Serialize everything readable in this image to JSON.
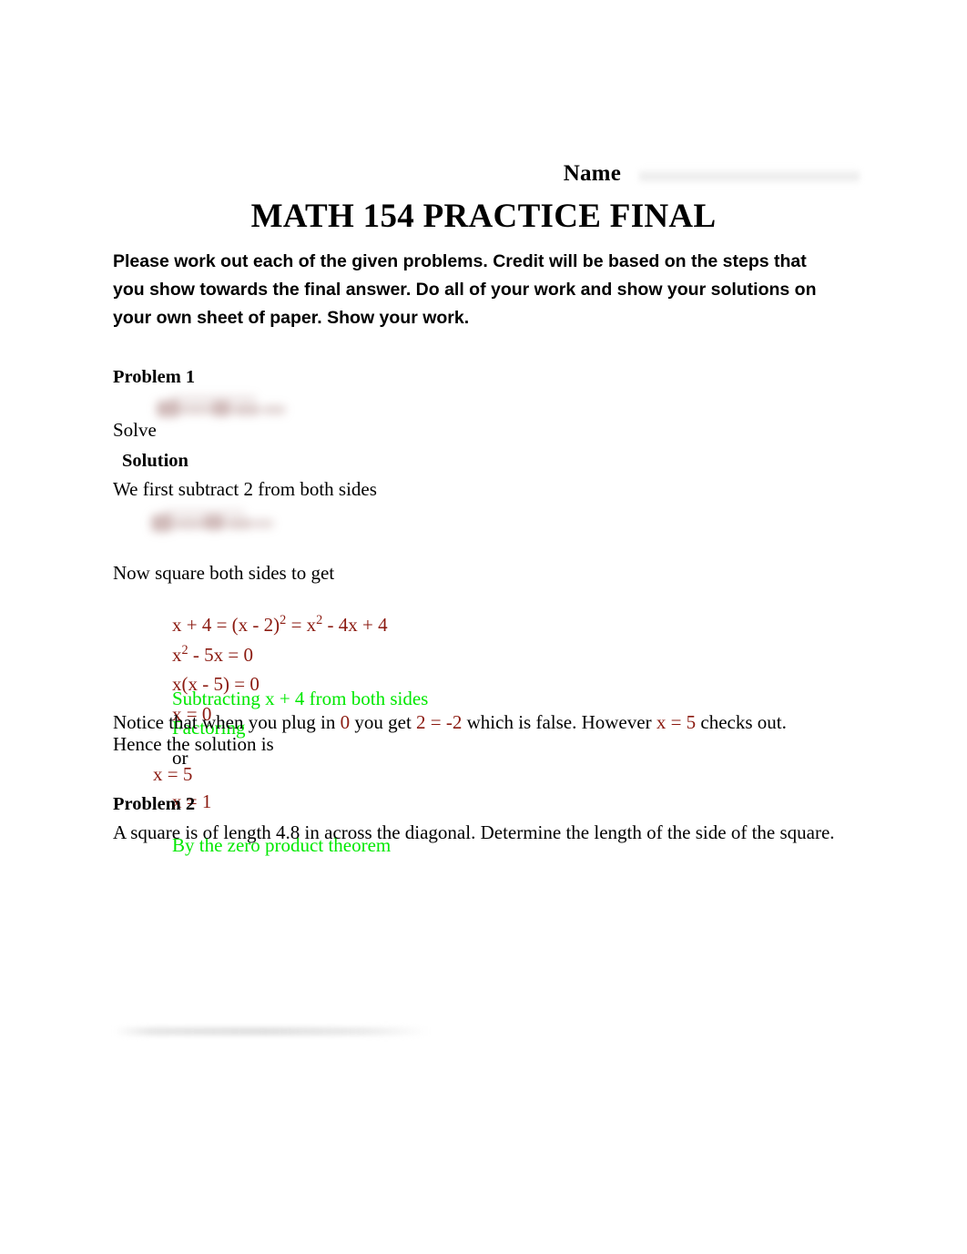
{
  "document": {
    "title": "MATH 154 PRACTICE FINAL",
    "name_label": "Name",
    "name_value": "",
    "instructions": "Please work out each of the given problems. Credit will be based on the steps that you show towards the final answer. Do all of your work and show your solutions on your own sheet of paper. Show your work."
  },
  "problem1": {
    "heading": "Problem 1",
    "prompt": "Solve",
    "prompt_equation_redacted": "",
    "solution_heading": "Solution",
    "step1_text": "We first subtract 2 from both sides",
    "step1_equation_redacted": "",
    "step2_text": "Now square both sides to get",
    "work": [
      {
        "expr_pre": "x + 4 = (x - 2)",
        "expr_sup": "2",
        "expr_post": " = x",
        "expr_sup2": "2",
        "expr_post2": " - 4x + 4",
        "note": ""
      },
      {
        "expr_pre": "x",
        "expr_sup": "2",
        "expr_post": " - 5x = 0",
        "note": "Subtracting x + 4 from both sides"
      },
      {
        "expr_pre": "x(x - 5) = 0",
        "note": "Factoring"
      }
    ],
    "zero_product_line": {
      "left": "x = 0",
      "conjunction": "or",
      "right": "x = 1",
      "note": "By the zero product theorem"
    },
    "check_sentence": {
      "part1": "Notice that when you plug in ",
      "value1": "0",
      "part2": " you get  ",
      "value2": "2 = -2",
      "part3": "  which is false. However  ",
      "value3": "x = 5",
      "part4": "  checks out. Hence the solution is"
    },
    "answer": "x = 5"
  },
  "problem2": {
    "heading": "Problem 2",
    "text": "A square is of length 4.8 in across the diagonal. Determine the length of the side of the square."
  },
  "colors": {
    "math": "#8B1A10",
    "annotation": "#00E800",
    "text": "#000000",
    "page": "#FFFFFF"
  }
}
